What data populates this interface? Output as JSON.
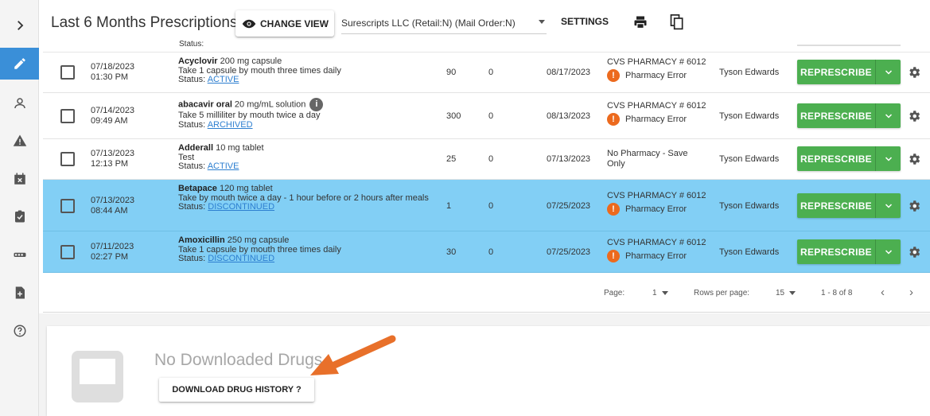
{
  "header": {
    "title": "Last 6 Months Prescriptions",
    "change_view_label": "CHANGE VIEW",
    "pharmacy_select_value": "Surescripts LLC (Retail:N) (Mail Order:N)",
    "settings_label": "SETTINGS"
  },
  "sidebar": {
    "items": [
      {
        "icon": "chevron-right-icon"
      },
      {
        "icon": "pencil-icon",
        "active": true
      },
      {
        "icon": "person-icon"
      },
      {
        "icon": "warning-icon"
      },
      {
        "icon": "calendar-icon"
      },
      {
        "icon": "clipboard-check-icon"
      },
      {
        "icon": "pill-bottle-icon"
      },
      {
        "icon": "document-add-icon"
      },
      {
        "icon": "help-icon"
      }
    ]
  },
  "hidden_row_status": "Status:",
  "rows": [
    {
      "date": "07/18/2023",
      "time": "01:30 PM",
      "drug_name": "Acyclovir",
      "drug_detail": " 200 mg capsule",
      "sig": "Take 1 capsule by mouth three times daily",
      "status_label": "Status: ",
      "status": "ACTIVE",
      "quantity": "90",
      "refills": "0",
      "end_date": "08/17/2023",
      "pharmacy": "CVS PHARMACY # 6012",
      "pharmacy_status": "Pharmacy Error",
      "prescriber": "Tyson Edwards",
      "selected": false
    },
    {
      "date": "07/14/2023",
      "time": "09:49 AM",
      "drug_name": "abacavir oral",
      "drug_detail": " 20 mg/mL solution",
      "sig": "Take 5 milliliter by mouth twice a day",
      "status_label": "Status: ",
      "status": "ARCHIVED",
      "quantity": "300",
      "refills": "0",
      "end_date": "08/13/2023",
      "pharmacy": "CVS PHARMACY # 6012",
      "pharmacy_status": "Pharmacy Error",
      "prescriber": "Tyson Edwards",
      "selected": false
    },
    {
      "date": "07/13/2023",
      "time": "12:13 PM",
      "drug_name": "Adderall",
      "drug_detail": " 10 mg tablet",
      "sig": "Test",
      "status_label": "Status: ",
      "status": "ACTIVE",
      "quantity": "25",
      "refills": "0",
      "end_date": "07/13/2023",
      "pharmacy": "No Pharmacy - Save Only",
      "pharmacy_status": "",
      "prescriber": "Tyson Edwards",
      "selected": false
    },
    {
      "date": "07/13/2023",
      "time": "08:44 AM",
      "drug_name": "Betapace",
      "drug_detail": " 120 mg tablet",
      "sig": "Take by mouth twice a day - 1 hour before or 2 hours after meals",
      "status_label": "Status: ",
      "status": "DISCONTINUED",
      "quantity": "1",
      "refills": "0",
      "end_date": "07/25/2023",
      "pharmacy": "CVS PHARMACY # 6012",
      "pharmacy_status": "Pharmacy Error",
      "prescriber": "Tyson Edwards",
      "selected": true
    },
    {
      "date": "07/11/2023",
      "time": "02:27 PM",
      "drug_name": "Amoxicillin",
      "drug_detail": " 250 mg capsule",
      "sig": "Take 1 capsule by mouth three times daily",
      "status_label": "Status: ",
      "status": "DISCONTINUED",
      "quantity": "30",
      "refills": "0",
      "end_date": "07/25/2023",
      "pharmacy": "CVS PHARMACY # 6012",
      "pharmacy_status": "Pharmacy Error",
      "prescriber": "Tyson Edwards",
      "selected": true
    }
  ],
  "represcribe_label": "REPRESCRIBE",
  "info_glyph": "i",
  "error_glyph": "!",
  "pagination": {
    "page_label": "Page:",
    "page_value": "1",
    "rows_label": "Rows per page:",
    "rows_value": "15",
    "range": "1 - 8 of 8",
    "prev": "‹",
    "next": "›"
  },
  "downloads": {
    "empty_text": "No Downloaded Drugs",
    "button_label": "DOWNLOAD DRUG HISTORY ?"
  },
  "colors": {
    "accent": "#3a8fd8",
    "selected_row": "#82cff5",
    "represcribe": "#4caf50",
    "error": "#ec6a1e",
    "annotation_arrow": "#e8702a"
  }
}
